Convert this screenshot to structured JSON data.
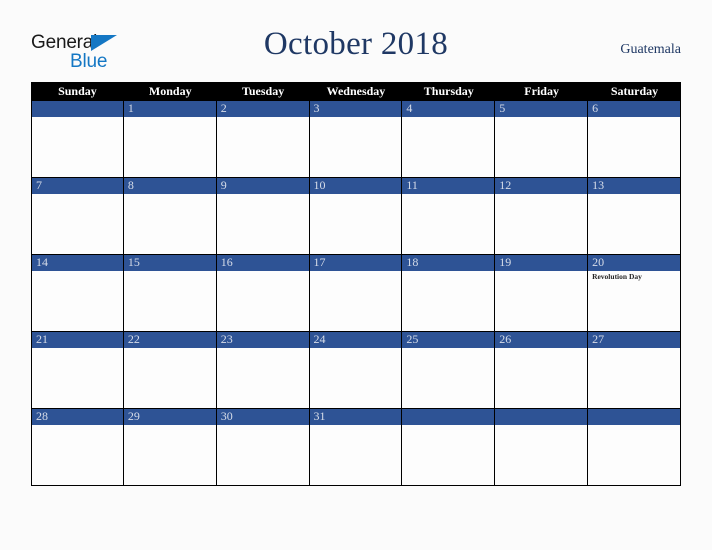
{
  "brand": {
    "name_part1": "General",
    "name_part2": "Blue",
    "triangle_color": "#1477c4",
    "text_color": "#1a1a1a"
  },
  "header": {
    "title": "October 2018",
    "country": "Guatemala",
    "title_color": "#1f3864"
  },
  "calendar": {
    "header_background": "#000000",
    "band_color": "#2e5395",
    "day_number_color": "#d6dce8",
    "weekdays": [
      "Sunday",
      "Monday",
      "Tuesday",
      "Wednesday",
      "Thursday",
      "Friday",
      "Saturday"
    ],
    "weeks": [
      [
        {
          "day": "",
          "event": ""
        },
        {
          "day": "1",
          "event": ""
        },
        {
          "day": "2",
          "event": ""
        },
        {
          "day": "3",
          "event": ""
        },
        {
          "day": "4",
          "event": ""
        },
        {
          "day": "5",
          "event": ""
        },
        {
          "day": "6",
          "event": ""
        }
      ],
      [
        {
          "day": "7",
          "event": ""
        },
        {
          "day": "8",
          "event": ""
        },
        {
          "day": "9",
          "event": ""
        },
        {
          "day": "10",
          "event": ""
        },
        {
          "day": "11",
          "event": ""
        },
        {
          "day": "12",
          "event": ""
        },
        {
          "day": "13",
          "event": ""
        }
      ],
      [
        {
          "day": "14",
          "event": ""
        },
        {
          "day": "15",
          "event": ""
        },
        {
          "day": "16",
          "event": ""
        },
        {
          "day": "17",
          "event": ""
        },
        {
          "day": "18",
          "event": ""
        },
        {
          "day": "19",
          "event": ""
        },
        {
          "day": "20",
          "event": "Revolution Day"
        }
      ],
      [
        {
          "day": "21",
          "event": ""
        },
        {
          "day": "22",
          "event": ""
        },
        {
          "day": "23",
          "event": ""
        },
        {
          "day": "24",
          "event": ""
        },
        {
          "day": "25",
          "event": ""
        },
        {
          "day": "26",
          "event": ""
        },
        {
          "day": "27",
          "event": ""
        }
      ],
      [
        {
          "day": "28",
          "event": ""
        },
        {
          "day": "29",
          "event": ""
        },
        {
          "day": "30",
          "event": ""
        },
        {
          "day": "31",
          "event": ""
        },
        {
          "day": "",
          "event": ""
        },
        {
          "day": "",
          "event": ""
        },
        {
          "day": "",
          "event": ""
        }
      ]
    ]
  }
}
